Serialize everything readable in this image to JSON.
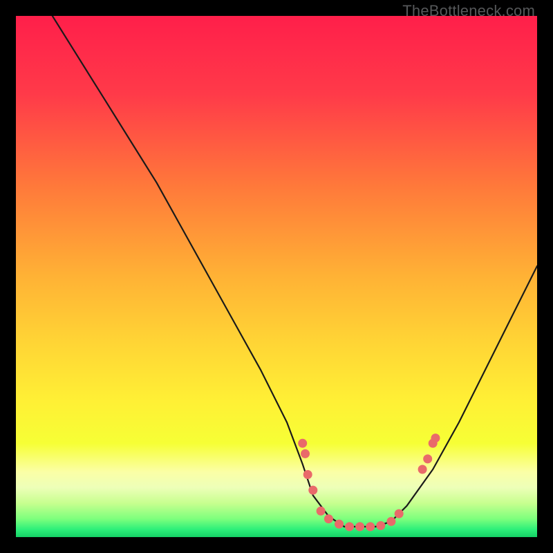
{
  "watermark": "TheBottleneck.com",
  "chart_data": {
    "type": "line",
    "title": "",
    "xlabel": "",
    "ylabel": "",
    "xlim": [
      0,
      100
    ],
    "ylim": [
      0,
      100
    ],
    "grid": false,
    "curve_note": "V-shaped bottleneck curve; y is an approximate percentage reading where 100 = top of plot and 0 = bottom. Flat minimum near x 57-72 at y ≈ 2.",
    "series": [
      {
        "name": "bottleneck-curve",
        "x": [
          7,
          12,
          17,
          22,
          27,
          32,
          37,
          42,
          47,
          52,
          55,
          57,
          60,
          63,
          66,
          69,
          72,
          75,
          80,
          85,
          90,
          95,
          100
        ],
        "y": [
          100,
          92,
          84,
          76,
          68,
          59,
          50,
          41,
          32,
          22,
          14,
          8,
          4,
          2,
          2,
          2,
          3,
          6,
          13,
          22,
          32,
          42,
          52
        ]
      }
    ],
    "markers_note": "Salmon dots cluster near the curve's lower shoulders and trough.",
    "markers": [
      {
        "x": 55,
        "y": 18
      },
      {
        "x": 55.5,
        "y": 16
      },
      {
        "x": 56,
        "y": 12
      },
      {
        "x": 57,
        "y": 9
      },
      {
        "x": 58.5,
        "y": 5
      },
      {
        "x": 60,
        "y": 3.5
      },
      {
        "x": 62,
        "y": 2.5
      },
      {
        "x": 64,
        "y": 2
      },
      {
        "x": 66,
        "y": 2
      },
      {
        "x": 68,
        "y": 2
      },
      {
        "x": 70,
        "y": 2.2
      },
      {
        "x": 72,
        "y": 3
      },
      {
        "x": 73.5,
        "y": 4.5
      },
      {
        "x": 78,
        "y": 13
      },
      {
        "x": 79,
        "y": 15
      },
      {
        "x": 80,
        "y": 18
      },
      {
        "x": 80.5,
        "y": 19
      }
    ],
    "colors": {
      "gradient_top": "#ff1f4a",
      "gradient_mid_upper": "#ff7a3a",
      "gradient_mid": "#ffd335",
      "gradient_mid_lower": "#f6ff35",
      "gradient_lower": "#e7ff6f",
      "gradient_bottom": "#19e36e",
      "curve": "#1a1a1a",
      "marker": "#e96a6a",
      "frame": "#000000"
    }
  }
}
